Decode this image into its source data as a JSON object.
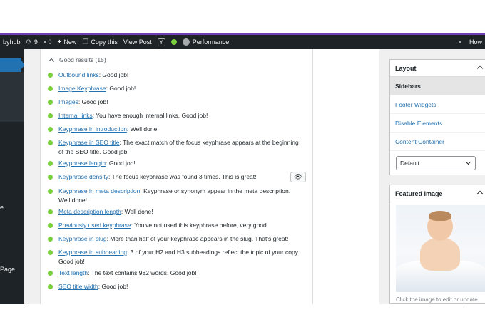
{
  "adminbar": {
    "site": "byhub",
    "updates_count": "9",
    "comments_count": "0",
    "new_label": "New",
    "copy_label": "Copy this",
    "view_label": "View Post",
    "yoast_letter": "Y",
    "performance_label": "Performance",
    "howdy_label": "How"
  },
  "sidebar": {
    "partial_label_1": "e",
    "partial_label_2": "Page"
  },
  "seo": {
    "header": "Good results (15)",
    "items": [
      {
        "link": "Outbound links",
        "text": ": Good job!"
      },
      {
        "link": "Image Keyphrase",
        "text": ": Good job!"
      },
      {
        "link": "Images",
        "text": ": Good job!"
      },
      {
        "link": "Internal links",
        "text": ": You have enough internal links. Good job!"
      },
      {
        "link": "Keyphrase in introduction",
        "text": ": Well done!"
      },
      {
        "link": "Keyphrase in SEO title",
        "text": ": The exact match of the focus keyphrase appears at the beginning of the SEO title. Good job!"
      },
      {
        "link": "Keyphrase length",
        "text": ": Good job!"
      },
      {
        "link": "Keyphrase density",
        "text": ": The focus keyphrase was found 3 times. This is great!"
      },
      {
        "link": "Keyphrase in meta description",
        "text": ": Keyphrase or synonym appear in the meta description. Well done!"
      },
      {
        "link": "Meta description length",
        "text": ": Well done!"
      },
      {
        "link": "Previously used keyphrase",
        "text": ": You've not used this keyphrase before, very good."
      },
      {
        "link": "Keyphrase in slug",
        "text": ": More than half of your keyphrase appears in the slug. That's great!"
      },
      {
        "link": "Keyphrase in subheading",
        "text": ": 3 of your H2 and H3 subheadings reflect the topic of your copy. Good job!"
      },
      {
        "link": "Text length",
        "text": ": The text contains 982 words. Good job!"
      },
      {
        "link": "SEO title width",
        "text": ": Good job!"
      }
    ]
  },
  "layout_box": {
    "title": "Layout",
    "rows": [
      "Sidebars",
      "Footer Widgets",
      "Disable Elements",
      "Content Container"
    ],
    "select_value": "Default"
  },
  "featured_image": {
    "title": "Featured image",
    "caption": "Click the image to edit or update"
  },
  "icons": {
    "updates": "refresh-icon",
    "comments": "comment-icon",
    "new": "plus-icon",
    "copy": "copy-icon",
    "eye": "eye-icon",
    "notification": "bell-icon"
  },
  "colors": {
    "adminbar_bg": "#1d2327",
    "accent_purple": "#6c3fb5",
    "link_blue": "#2271b1",
    "good_green": "#7ad03a"
  }
}
